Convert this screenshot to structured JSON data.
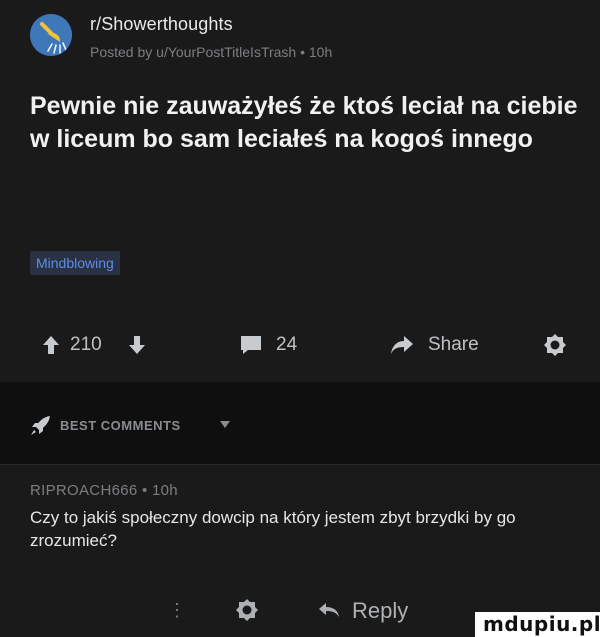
{
  "post": {
    "subreddit": "r/Showerthoughts",
    "posted_by": "Posted by u/YourPostTitleIsTrash • 10h",
    "title": "Pewnie nie zauważyłeś że ktoś leciał na ciebie w liceum bo sam leciałeś na kogoś innego",
    "flair": "Mindblowing",
    "upvotes": "210",
    "comments": "24",
    "share_label": "Share"
  },
  "best_comments": {
    "label": "BEST COMMENTS"
  },
  "comment": {
    "author_time": "RIPROACH666 • 10h",
    "body": "Czy to jakiś społeczny dowcip na który jestem zbyt brzydki by go zrozumieć?",
    "dots": "⋮",
    "reply_label": "Reply"
  },
  "watermark": "mdupiu.pl",
  "colors": {
    "background": "#1a1a1b",
    "best_bar": "#0f0f10",
    "flair_bg": "#2a3142",
    "flair_text": "#5a8ee8",
    "avatar": "#3f78b8"
  },
  "icons": [
    "upvote-icon",
    "downvote-icon",
    "comment-icon",
    "share-icon",
    "award-icon",
    "rocket-icon",
    "chevron-down-icon",
    "reply-icon"
  ]
}
